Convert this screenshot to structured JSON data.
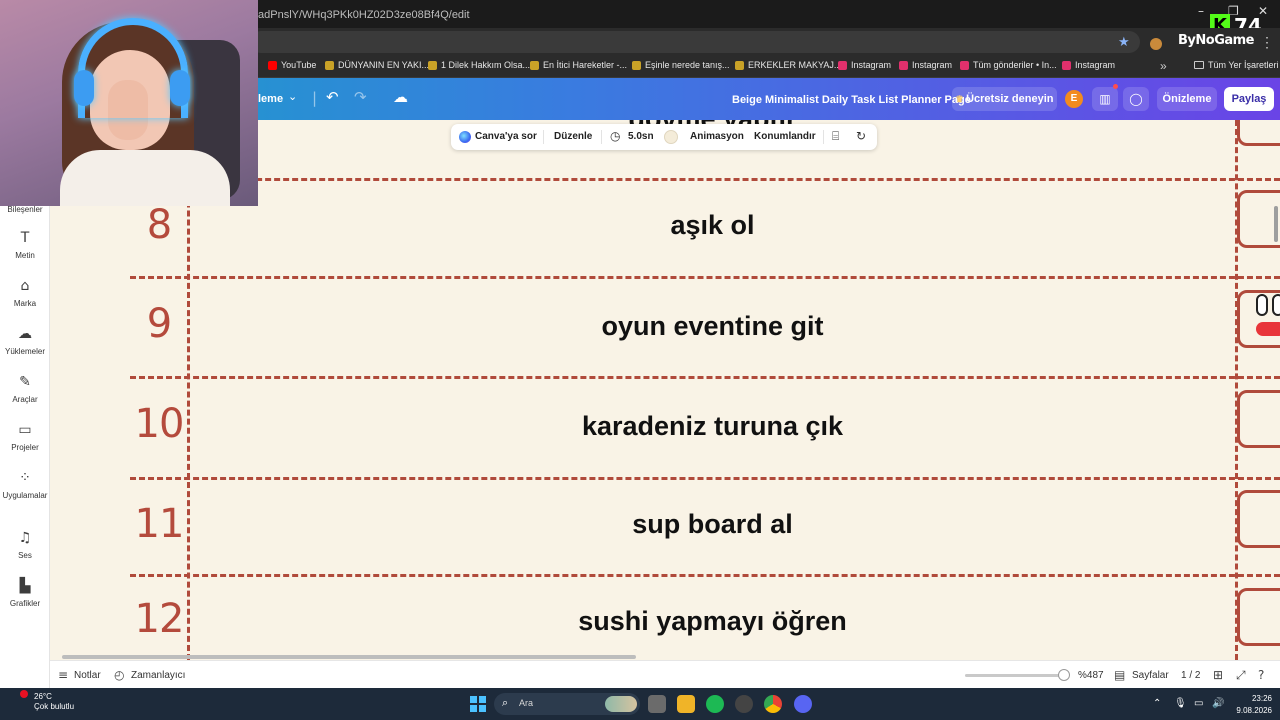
{
  "browser": {
    "url": "adPnslY/WHq3PKk0HZ02D3ze08Bf4Q/edit",
    "brand_extension": "ByNoGame",
    "kick_count": "74",
    "bookmarks": [
      {
        "label": "YouTube",
        "color": "#ff0000"
      },
      {
        "label": "DÜNYANIN EN YAKI...",
        "color": "#c9a227"
      },
      {
        "label": "1 Dilek Hakkım Olsa...",
        "color": "#c9a227"
      },
      {
        "label": "En İtici Hareketler -...",
        "color": "#c9a227"
      },
      {
        "label": "Eşinle nerede tanış...",
        "color": "#c9a227"
      },
      {
        "label": "ERKEKLER MAKYAJ...",
        "color": "#c9a227"
      },
      {
        "label": "Instagram",
        "color": "#e1306c"
      },
      {
        "label": "Instagram",
        "color": "#e1306c"
      },
      {
        "label": "Tüm gönderiler • In...",
        "color": "#e1306c"
      },
      {
        "label": "Instagram",
        "color": "#e1306c"
      }
    ],
    "all_bookmarks": "Tüm Yer İşaretleri"
  },
  "canva_header": {
    "menu_partial": "leme",
    "doc_title": "Beige Minimalist Daily Task List Planner Page",
    "try_button": "Ücretsiz deneyin",
    "avatar_letter": "E",
    "preview_button": "Önizleme",
    "share_button": "Paylaş"
  },
  "sidebar": {
    "partial_top_label": "Bileşenler",
    "items": [
      {
        "label": "Metin",
        "icon": "text-icon"
      },
      {
        "label": "Marka",
        "icon": "brand-icon"
      },
      {
        "label": "Yüklemeler",
        "icon": "upload-icon"
      },
      {
        "label": "Araçlar",
        "icon": "tools-icon"
      },
      {
        "label": "Projeler",
        "icon": "folder-icon"
      },
      {
        "label": "Uygulamalar",
        "icon": "apps-icon"
      },
      {
        "label": "Ses",
        "icon": "music-icon"
      },
      {
        "label": "Grafikler",
        "icon": "charts-icon"
      }
    ]
  },
  "toolbar": {
    "ask_canva": "Canva'ya sor",
    "edit": "Düzenle",
    "duration": "5.0sn",
    "animation": "Animasyon",
    "position": "Konumlandır"
  },
  "task_list": {
    "partial_top_text": "dövme yaptır",
    "rows": [
      {
        "number": "8",
        "task": "aşık ol"
      },
      {
        "number": "9",
        "task": "oyun eventine git"
      },
      {
        "number": "10",
        "task": "karadeniz turuna çık"
      },
      {
        "number": "11",
        "task": "sup board al"
      },
      {
        "number": "12",
        "task": "sushi yapmayı öğren"
      }
    ]
  },
  "statusbar": {
    "notes": "Notlar",
    "timer": "Zamanlayıcı",
    "zoom": "%487",
    "pages_label": "Sayfalar",
    "page_count": "1 / 2"
  },
  "taskbar": {
    "weather_temp": "26°C",
    "weather_desc": "Çok bulutlu",
    "search_placeholder": "Ara",
    "time": "23:26",
    "date": "9.08.2026"
  }
}
